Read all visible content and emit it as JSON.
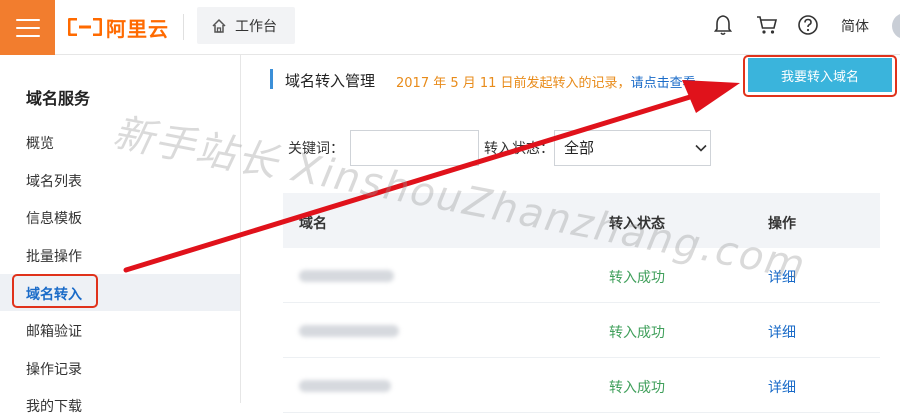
{
  "header": {
    "logo_text": "阿里云",
    "workbench_label": "工作台",
    "lang_label": "简体"
  },
  "sidebar": {
    "title": "域名服务",
    "items": [
      {
        "label": "概览"
      },
      {
        "label": "域名列表"
      },
      {
        "label": "信息模板"
      },
      {
        "label": "批量操作"
      },
      {
        "label": "域名转入",
        "active": true
      },
      {
        "label": "邮箱验证"
      },
      {
        "label": "操作记录"
      },
      {
        "label": "我的下载"
      }
    ]
  },
  "main": {
    "title": "域名转入管理",
    "notice_text": "2017 年 5 月 11 日前发起转入的记录，",
    "notice_link": "请点击查看",
    "primary_button": "我要转入域名",
    "filters": {
      "keyword_label": "关键词：",
      "keyword_value": "",
      "status_label": "转入状态：",
      "status_value": "全部"
    },
    "table": {
      "columns": [
        "域名",
        "转入状态",
        "操作"
      ],
      "rows": [
        {
          "domain": "",
          "status": "转入成功",
          "action": "详细"
        },
        {
          "domain": "",
          "status": "转入成功",
          "action": "详细"
        },
        {
          "domain": "",
          "status": "转入成功",
          "action": "详细"
        }
      ]
    }
  },
  "watermark": "新手站长 XinshouZhanzhang.com",
  "colors": {
    "brand": "#ff6a00",
    "menu_bg": "#f27d2e",
    "primary": "#3ab4dc",
    "link": "#1a6bc8",
    "success": "#41a05c",
    "annotation": "#e0321b",
    "notice": "#e88b1a"
  }
}
